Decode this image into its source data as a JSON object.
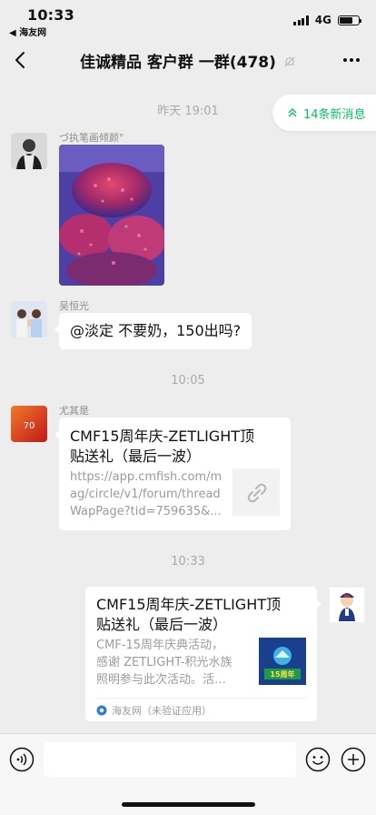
{
  "status_bar": {
    "time": "10:33",
    "back_app": "◀ 海友网",
    "network": "4G",
    "battery_level": 0.7
  },
  "nav": {
    "title": "佳诚精品 客户群 一群(478)"
  },
  "new_messages": {
    "label": "14条新消息"
  },
  "messages": [
    {
      "type": "time",
      "text": "昨天 19:01"
    },
    {
      "type": "image",
      "sender": "づ执笔画倾颜°"
    },
    {
      "type": "text",
      "sender": "吴恒光",
      "text": "@淡定 不要奶，150出吗?"
    },
    {
      "type": "time",
      "text": "10:05"
    },
    {
      "type": "link",
      "sender": "尤其是",
      "title": "CMF15周年庆-ZETLIGHT顶贴送礼（最后一波）",
      "title_line1": "CMF15周年庆-ZETLIGHT顶",
      "title_line2": "贴送礼（最后一波）",
      "url": "https://app.cmfish.com/mag/circle/v1/forum/threadWapPage?tid=759635&…",
      "url_line1": "https://app.cmfish.com/m",
      "url_line2": "ag/circle/v1/forum/thread",
      "url_line3": "WapPage?tid=759635&..."
    },
    {
      "type": "time",
      "text": "10:33"
    },
    {
      "type": "app-link",
      "sender": "self",
      "title_line1": "CMF15周年庆-ZETLIGHT顶",
      "title_line2": "贴送礼（最后一波）",
      "desc_line1": "CMF-15周年庆典活动，",
      "desc_line2": "感谢 ZETLIGHT-积光水族",
      "desc_line3": "照明参与此次活动。活…",
      "thumb_text": "15周年",
      "source": "海友网（未验证应用）"
    }
  ],
  "colors": {
    "background": "#ededed",
    "accent_green": "#07c160",
    "bubble": "#ffffff"
  }
}
